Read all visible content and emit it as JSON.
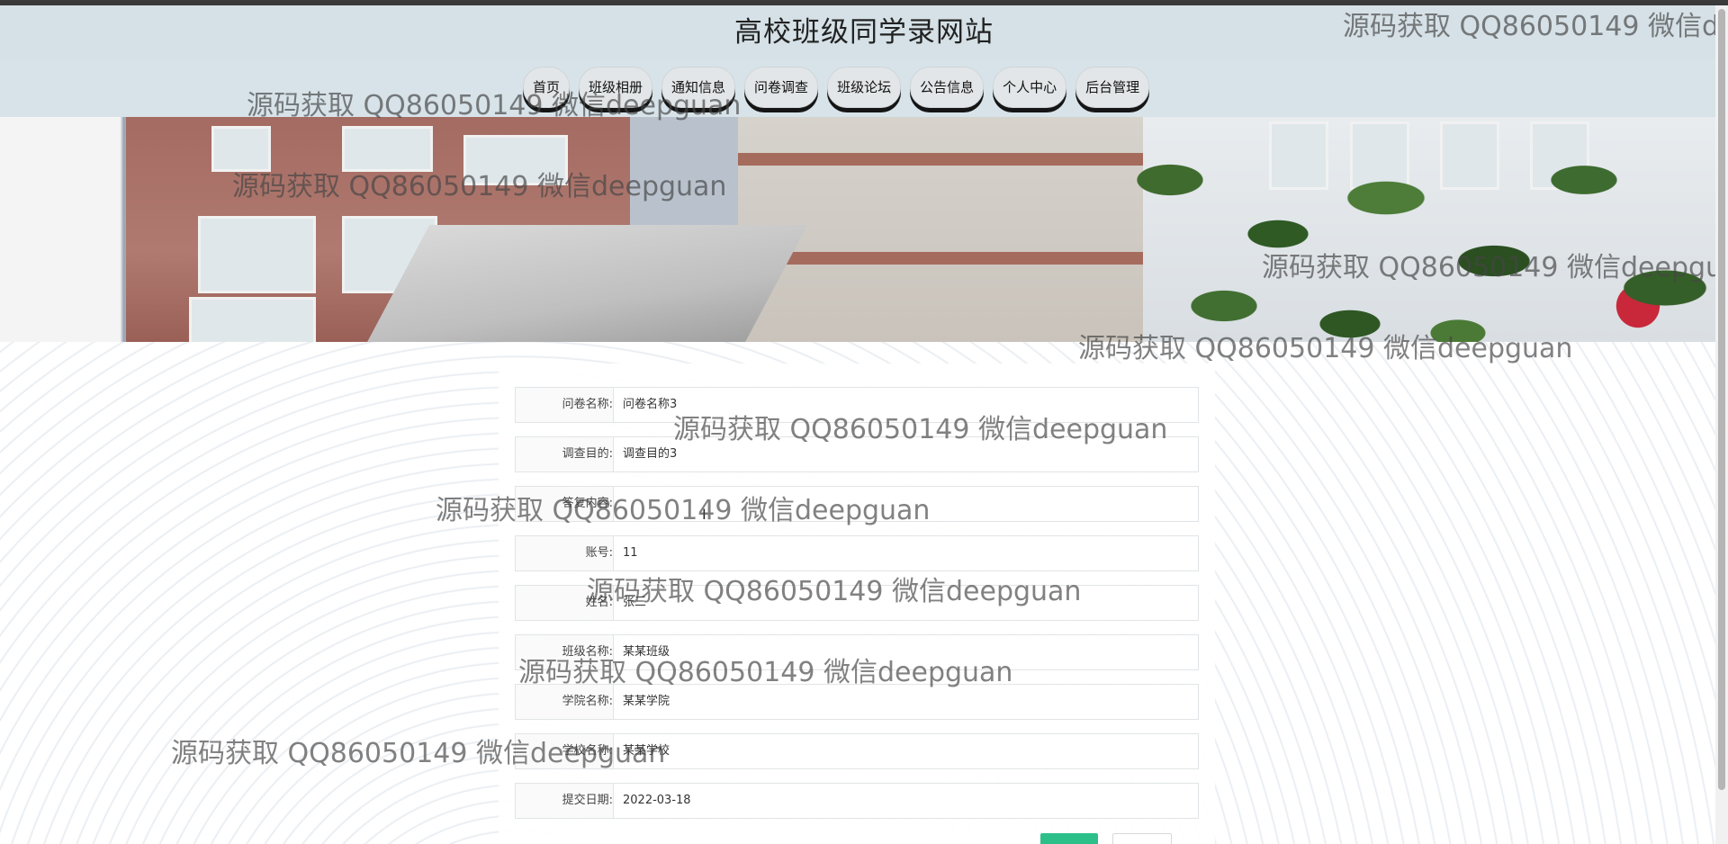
{
  "site": {
    "title": "高校班级同学录网站"
  },
  "nav": {
    "items": [
      {
        "label": "首页"
      },
      {
        "label": "班级相册"
      },
      {
        "label": "通知信息"
      },
      {
        "label": "问卷调查"
      },
      {
        "label": "班级论坛"
      },
      {
        "label": "公告信息"
      },
      {
        "label": "个人中心"
      },
      {
        "label": "后台管理"
      }
    ]
  },
  "form": {
    "fields": [
      {
        "label": "问卷名称:",
        "value": "问卷名称3"
      },
      {
        "label": "调查目的:",
        "value": "调查目的3"
      },
      {
        "label": "答复内容:",
        "value": ""
      },
      {
        "label": "账号:",
        "value": "11"
      },
      {
        "label": "姓名:",
        "value": "张三"
      },
      {
        "label": "班级名称:",
        "value": "某某班级"
      },
      {
        "label": "学院名称:",
        "value": "某某学院"
      },
      {
        "label": "学校名称:",
        "value": "某某学校"
      },
      {
        "label": "提交日期:",
        "value": "2022-03-18"
      }
    ]
  },
  "watermark": {
    "text": "源码获取 QQ86050149 微信deepguan"
  },
  "colors": {
    "header_bg": "#d5e1e6",
    "submit_button": "#2dbf8a"
  }
}
